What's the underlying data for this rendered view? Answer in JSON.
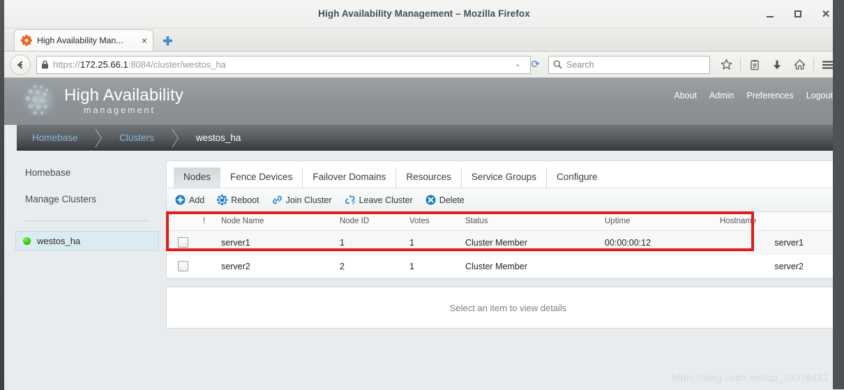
{
  "window": {
    "title": "High Availability Management – Mozilla Firefox",
    "minimize_label": "Minimize",
    "maximize_label": "Maximize",
    "close_label": "Close"
  },
  "browser": {
    "tab": {
      "title": "High Availability Man...",
      "close_label": "×",
      "favicon": "gear-icon"
    },
    "new_tab_label": "+",
    "back_label": "Back",
    "url": {
      "scheme": "https://",
      "host": "172.25.66.1",
      "port_path": ":8084/cluster/westos_ha",
      "full": "https://172.25.66.1:8084/cluster/westos_ha"
    },
    "url_dropdown": "⌄",
    "reload_label": "⟳",
    "search": {
      "placeholder": "Search",
      "value": ""
    },
    "icons": [
      {
        "name": "bookmark-star-icon",
        "glyph": "★"
      },
      {
        "name": "reader-list-icon",
        "glyph": "▤"
      },
      {
        "name": "downloads-icon",
        "glyph": "⬇"
      },
      {
        "name": "home-icon",
        "glyph": "⌂"
      },
      {
        "name": "hamburger-menu-icon",
        "glyph": "☰"
      }
    ]
  },
  "app": {
    "logo_title": "High Availability",
    "logo_subtitle": "management",
    "nav": [
      {
        "label": "About"
      },
      {
        "label": "Admin"
      },
      {
        "label": "Preferences"
      },
      {
        "label": "Logout"
      }
    ],
    "breadcrumb": [
      {
        "label": "Homebase",
        "current": false
      },
      {
        "label": "Clusters",
        "current": false
      },
      {
        "label": "westos_ha",
        "current": true
      }
    ],
    "sidebar": {
      "links": [
        {
          "label": "Homebase"
        },
        {
          "label": "Manage Clusters"
        }
      ],
      "clusters": [
        {
          "label": "westos_ha",
          "status": "online",
          "status_color": "#3cbf10"
        }
      ]
    },
    "tabs": [
      {
        "label": "Nodes",
        "active": true
      },
      {
        "label": "Fence Devices",
        "active": false
      },
      {
        "label": "Failover Domains",
        "active": false
      },
      {
        "label": "Resources",
        "active": false
      },
      {
        "label": "Service Groups",
        "active": false
      },
      {
        "label": "Configure",
        "active": false
      }
    ],
    "toolbar": [
      {
        "label": "Add",
        "icon": "plus-circle-icon"
      },
      {
        "label": "Reboot",
        "icon": "power-gear-icon"
      },
      {
        "label": "Join Cluster",
        "icon": "link-icon"
      },
      {
        "label": "Leave Cluster",
        "icon": "broken-link-icon"
      },
      {
        "label": "Delete",
        "icon": "x-circle-icon"
      }
    ],
    "table": {
      "headers": [
        "",
        "!",
        "Node Name",
        "Node ID",
        "Votes",
        "Status",
        "Uptime",
        "Hostname",
        ""
      ],
      "rows": [
        {
          "checked": false,
          "flag": "",
          "node_name": "server1",
          "node_id": "1",
          "votes": "1",
          "status": "Cluster Member",
          "uptime": "00:00:00:12",
          "hostname": "server1"
        },
        {
          "checked": false,
          "flag": "",
          "node_name": "server2",
          "node_id": "2",
          "votes": "1",
          "status": "Cluster Member",
          "uptime": "",
          "hostname": "server2"
        }
      ]
    },
    "detail_placeholder": "Select an item to view details",
    "highlight_color": "#e01c1c"
  },
  "watermark": "https://blog.csdn.net/qq_39376481"
}
